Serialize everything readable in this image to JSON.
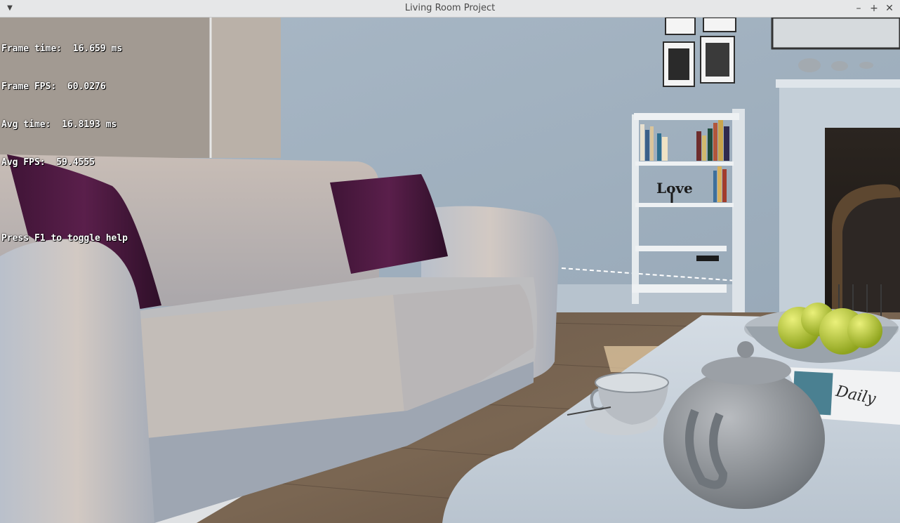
{
  "window": {
    "title": "Living Room Project",
    "menu_icon": "chevron-down-icon",
    "buttons": {
      "minimize": "–",
      "maximize": "+",
      "close": "✕"
    }
  },
  "hud": {
    "frame_time": "Frame time:  16.659 ms",
    "frame_fps": "Frame FPS:  60.0276",
    "avg_time": "Avg time:  16.8193 ms",
    "avg_fps": "Avg FPS:  59.4555",
    "help": "Press F1 to toggle help"
  },
  "scene": {
    "shelf_sign": "Love",
    "newspaper": "Daily"
  }
}
